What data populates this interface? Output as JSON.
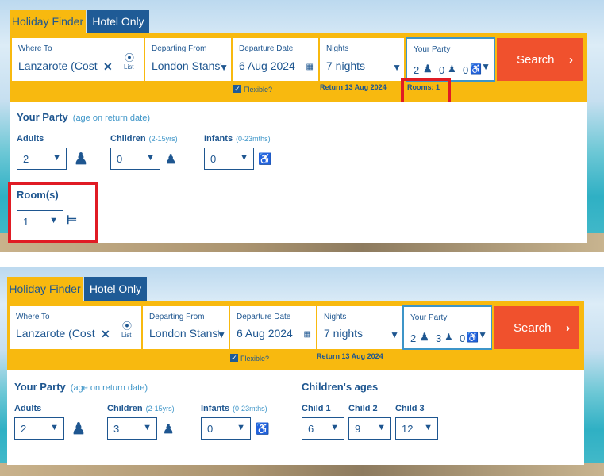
{
  "tabs": {
    "holiday": "Holiday Finder",
    "hotel": "Hotel Only"
  },
  "fields": {
    "where_to": {
      "label": "Where To",
      "value": "Lanzarote (Costa T",
      "list": "List"
    },
    "departing_from": {
      "label": "Departing From",
      "value": "London Stanste"
    },
    "departure_date": {
      "label": "Departure Date",
      "value": "6 Aug 2024"
    },
    "nights": {
      "label": "Nights",
      "value": "7 nights"
    },
    "your_party": {
      "label": "Your Party"
    }
  },
  "search_label": "Search",
  "flexible_label": "Flexible?",
  "return_text": "Return 13 Aug 2024",
  "rooms_summary": "Rooms: 1",
  "party": {
    "title": "Your Party",
    "subtitle": "(age on return date)",
    "adults_label": "Adults",
    "children_label": "Children",
    "children_hint": "(2-15yrs)",
    "infants_label": "Infants",
    "infants_hint": "(0-23mths)",
    "rooms_label": "Room(s)"
  },
  "top": {
    "party_counts": {
      "adults": "2",
      "children": "0",
      "infants": "0"
    },
    "adults_value": "2",
    "children_value": "0",
    "infants_value": "0",
    "rooms_value": "1"
  },
  "bottom": {
    "party_counts": {
      "adults": "2",
      "children": "3",
      "infants": "0"
    },
    "adults_value": "2",
    "children_value": "3",
    "infants_value": "0",
    "children_ages": {
      "title": "Children's ages",
      "child1_label": "Child 1",
      "child1_value": "6",
      "child2_label": "Child 2",
      "child2_value": "9",
      "child3_label": "Child 3",
      "child3_value": "12"
    }
  },
  "colors": {
    "accent": "#f8b90f",
    "brand_blue": "#1e5690",
    "search": "#f0512d",
    "highlight": "#e01b24"
  }
}
